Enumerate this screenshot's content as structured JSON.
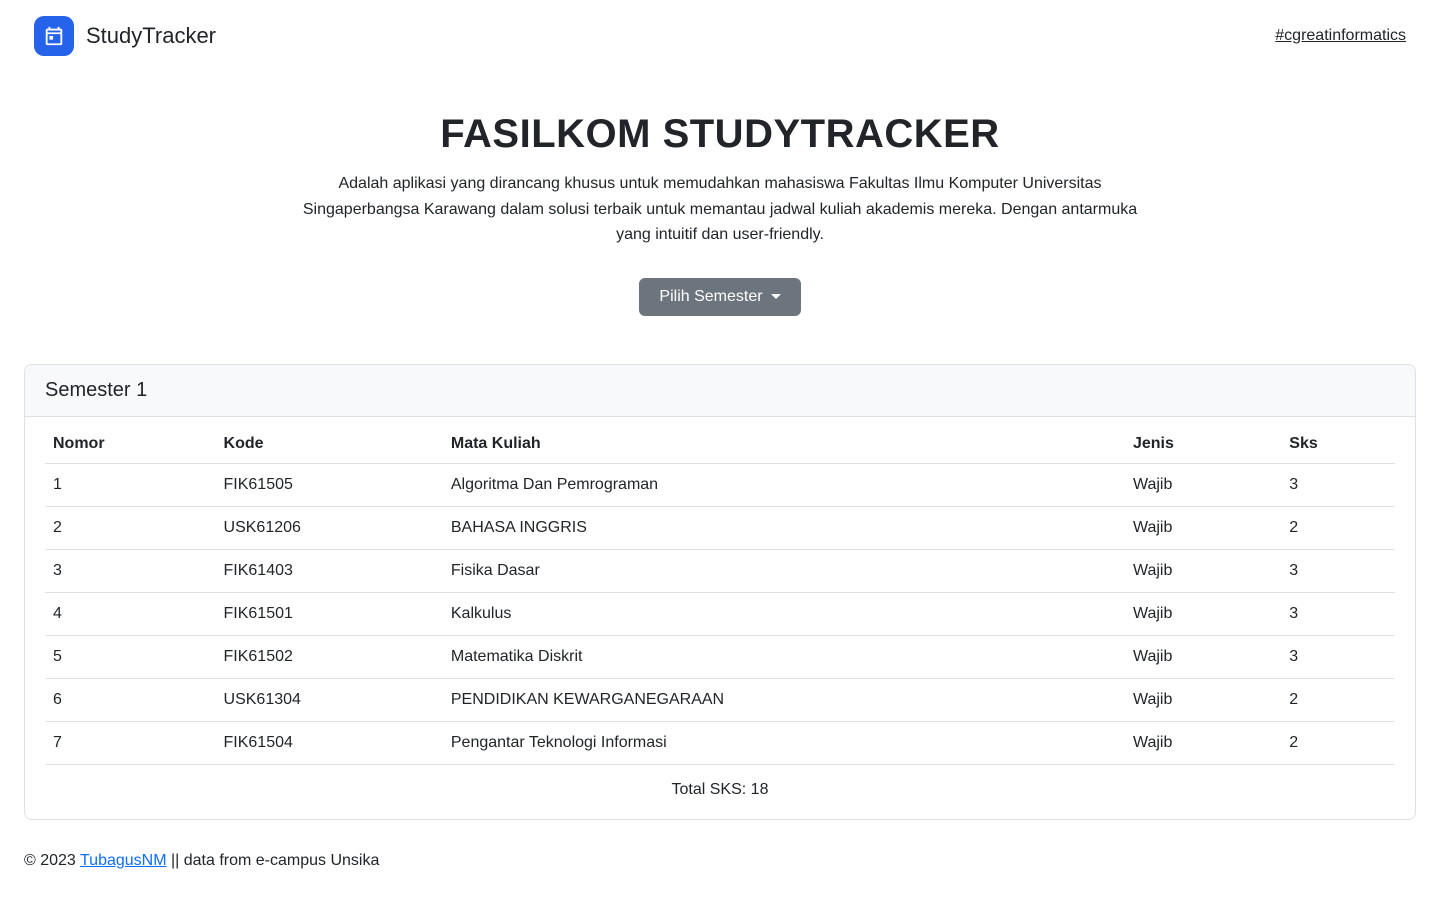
{
  "nav": {
    "brand": "StudyTracker",
    "hashlink": "#cgreatinformatics"
  },
  "hero": {
    "title": "FASILKOM STUDYTRACKER",
    "description": "Adalah aplikasi yang dirancang khusus untuk memudahkan mahasiswa Fakultas Ilmu Komputer Universitas Singaperbangsa Karawang dalam solusi terbaik untuk memantau jadwal kuliah akademis mereka. Dengan antarmuka yang intuitif dan user-friendly.",
    "dropdown_label": "Pilih Semester"
  },
  "card": {
    "header": "Semester 1",
    "columns": {
      "nomor": "Nomor",
      "kode": "Kode",
      "mk": "Mata Kuliah",
      "jenis": "Jenis",
      "sks": "Sks"
    },
    "rows": [
      {
        "nomor": "1",
        "kode": "FIK61505",
        "mk": "Algoritma Dan Pemrograman",
        "jenis": "Wajib",
        "sks": "3"
      },
      {
        "nomor": "2",
        "kode": "USK61206",
        "mk": "BAHASA INGGRIS",
        "jenis": "Wajib",
        "sks": "2"
      },
      {
        "nomor": "3",
        "kode": "FIK61403",
        "mk": "Fisika Dasar",
        "jenis": "Wajib",
        "sks": "3"
      },
      {
        "nomor": "4",
        "kode": "FIK61501",
        "mk": "Kalkulus",
        "jenis": "Wajib",
        "sks": "3"
      },
      {
        "nomor": "5",
        "kode": "FIK61502",
        "mk": "Matematika Diskrit",
        "jenis": "Wajib",
        "sks": "3"
      },
      {
        "nomor": "6",
        "kode": "USK61304",
        "mk": "PENDIDIKAN KEWARGANEGARAAN",
        "jenis": "Wajib",
        "sks": "2"
      },
      {
        "nomor": "7",
        "kode": "FIK61504",
        "mk": "Pengantar Teknologi Informasi",
        "jenis": "Wajib",
        "sks": "2"
      }
    ],
    "total_label": "Total SKS: 18"
  },
  "footer": {
    "prefix": "© 2023 ",
    "author": "TubagusNM",
    "suffix": " || data from e-campus Unsika"
  }
}
